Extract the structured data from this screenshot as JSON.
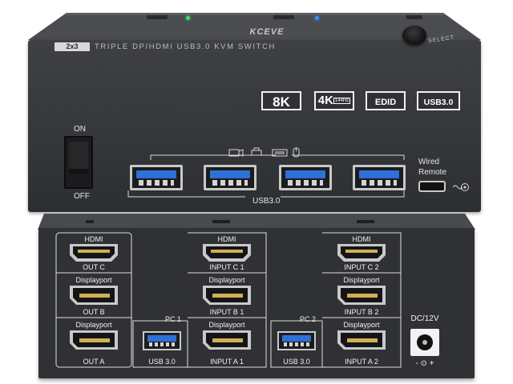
{
  "front": {
    "brand": "KCEVE",
    "model_tag": "2x3",
    "subtitle": "TRIPLE DP/HDMI USB3.0 KVM SWITCH",
    "select_label": "SELECT",
    "badges": {
      "eight_k": "8K",
      "four_k": "4K",
      "four_k_sub": "144Hz",
      "edid": "EDID",
      "usb": "USB3.0"
    },
    "power": {
      "on": "ON",
      "off": "OFF"
    },
    "usb_label": "USB3.0",
    "wired_remote": "Wired Remote",
    "led_colors": {
      "left": "#35e06a",
      "right": "#3a8bff"
    }
  },
  "rear": {
    "out_column": {
      "hdmi": "HDMI",
      "out_c": "OUT C",
      "dp_b": "Displayport",
      "out_b": "OUT B",
      "dp_a": "Displayport",
      "out_a": "OUT A"
    },
    "pc1": {
      "hdmi": "HDMI",
      "in_c": "INPUT C 1",
      "dp_b": "Displayport",
      "in_b": "INPUT B 1",
      "dp_a": "Displayport",
      "in_a": "INPUT A 1",
      "pc_label": "PC 1",
      "usb_label": "USB 3.0"
    },
    "pc2": {
      "hdmi": "HDMI",
      "in_c": "INPUT C 2",
      "dp_b": "Displayport",
      "in_b": "INPUT B 2",
      "dp_a": "Displayport",
      "in_a": "INPUT A 2",
      "pc_label": "PC 2",
      "usb_label": "USB 3.0"
    },
    "dc_label": "DC/12V",
    "polarity": "- ⊙ +"
  }
}
